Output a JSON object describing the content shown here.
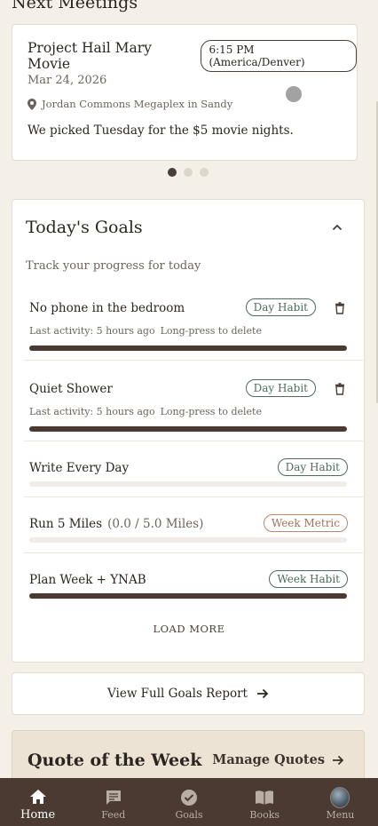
{
  "meetings": {
    "heading": "Next Meetings",
    "card": {
      "title": "Project Hail Mary Movie",
      "time": "6:15 PM (America/Denver)",
      "date": "Mar 24, 2026",
      "location": "Jordan Commons Megaplex in Sandy",
      "note": "We picked Tuesday for the $5 movie nights."
    },
    "carousel_dots": 3,
    "active_dot": 0
  },
  "goals": {
    "title": "Today's Goals",
    "subtitle": "Track your progress for today",
    "items": [
      {
        "name": "No phone in the bedroom",
        "extra": "",
        "badge": "Day Habit",
        "badge_type": "habit",
        "last_activity": "Last activity: 5 hours ago",
        "hint": "Long-press to delete",
        "progress": 1.0,
        "trash_icon": "trash-icon"
      },
      {
        "name": "Quiet Shower",
        "extra": "",
        "badge": "Day Habit",
        "badge_type": "habit",
        "last_activity": "Last activity: 5 hours ago",
        "hint": "Long-press to delete",
        "progress": 1.0,
        "trash_icon": "trash-icon"
      },
      {
        "name": "Write Every Day",
        "extra": "",
        "badge": "Day Habit",
        "badge_type": "habit",
        "progress": 0.0
      },
      {
        "name": "Run 5 Miles",
        "extra": "(0.0 / 5.0 Miles)",
        "badge": "Week Metric",
        "badge_type": "metric",
        "progress": 0.0
      },
      {
        "name": "Plan Week + YNAB",
        "extra": "",
        "badge": "Week Habit",
        "badge_type": "habit",
        "progress": 1.0
      }
    ],
    "load_more": "LOAD MORE",
    "collapse_icon": "chevron-up-icon"
  },
  "report_button": {
    "label": "View Full Goals Report",
    "icon": "arrow-right-icon"
  },
  "quote": {
    "title": "Quote of the Week",
    "manage_label": "Manage Quotes",
    "icon": "arrow-right-icon"
  },
  "nav": [
    {
      "label": "Home",
      "icon": "home-icon",
      "active": true
    },
    {
      "label": "Feed",
      "icon": "chat-icon",
      "active": false
    },
    {
      "label": "Goals",
      "icon": "check-circle-icon",
      "active": false
    },
    {
      "label": "Books",
      "icon": "book-icon",
      "active": false
    },
    {
      "label": "Menu",
      "icon": "avatar",
      "active": false
    }
  ],
  "colors": {
    "background": "#f4f0e8",
    "nav": "#4a3a31",
    "habit": "#4e6b5c",
    "metric": "#a0715a",
    "progress": "#4a3a31"
  }
}
